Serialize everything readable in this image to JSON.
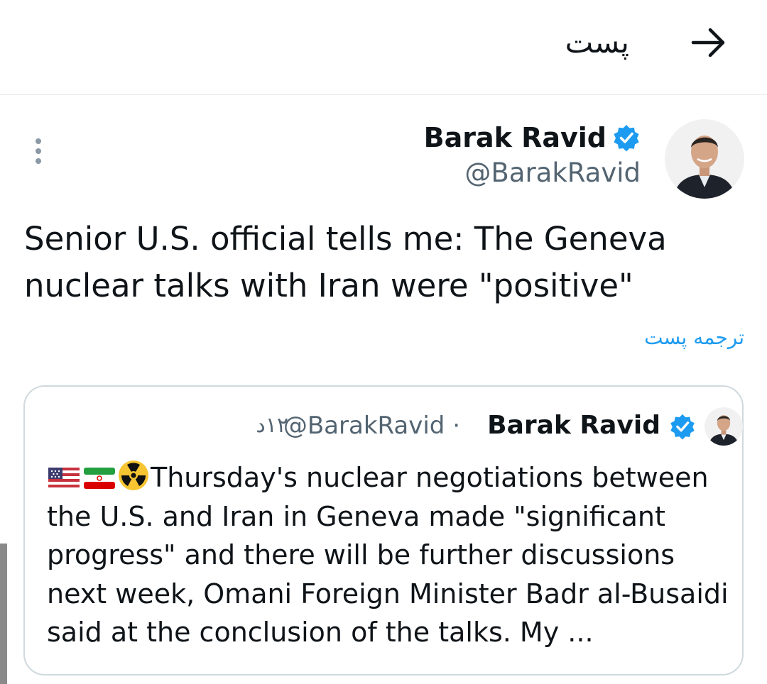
{
  "header": {
    "title": "پست",
    "back_icon": "arrow-right-icon"
  },
  "tweet": {
    "author_name": "Barak Ravid",
    "handle": "@BarakRavid",
    "verified_icon": "verified-badge-icon",
    "more_icon": "more-vertical-icon",
    "text": "Senior U.S. official tells me: The Geneva\nnuclear talks with Iran were \"positive\"",
    "translate_label": "ترجمه پست"
  },
  "quote": {
    "author_name": "Barak Ravid",
    "handle": "@BarakRavid",
    "separator": "·",
    "time": "۱۲د",
    "emojis": [
      "flag-us-icon",
      "flag-iran-icon",
      "radioactive-icon"
    ],
    "text": "Thursday's nuclear negotiations between the U.S. and Iran in Geneva made \"significant progress\" and there will be further discussions next week, Omani Foreign Minister Badr al-Busaidi said at the conclusion of the talks. My ..."
  },
  "colors": {
    "accent": "#1d9bf0",
    "text": "#0f1419",
    "secondary": "#536471",
    "border": "#cfd9de"
  }
}
